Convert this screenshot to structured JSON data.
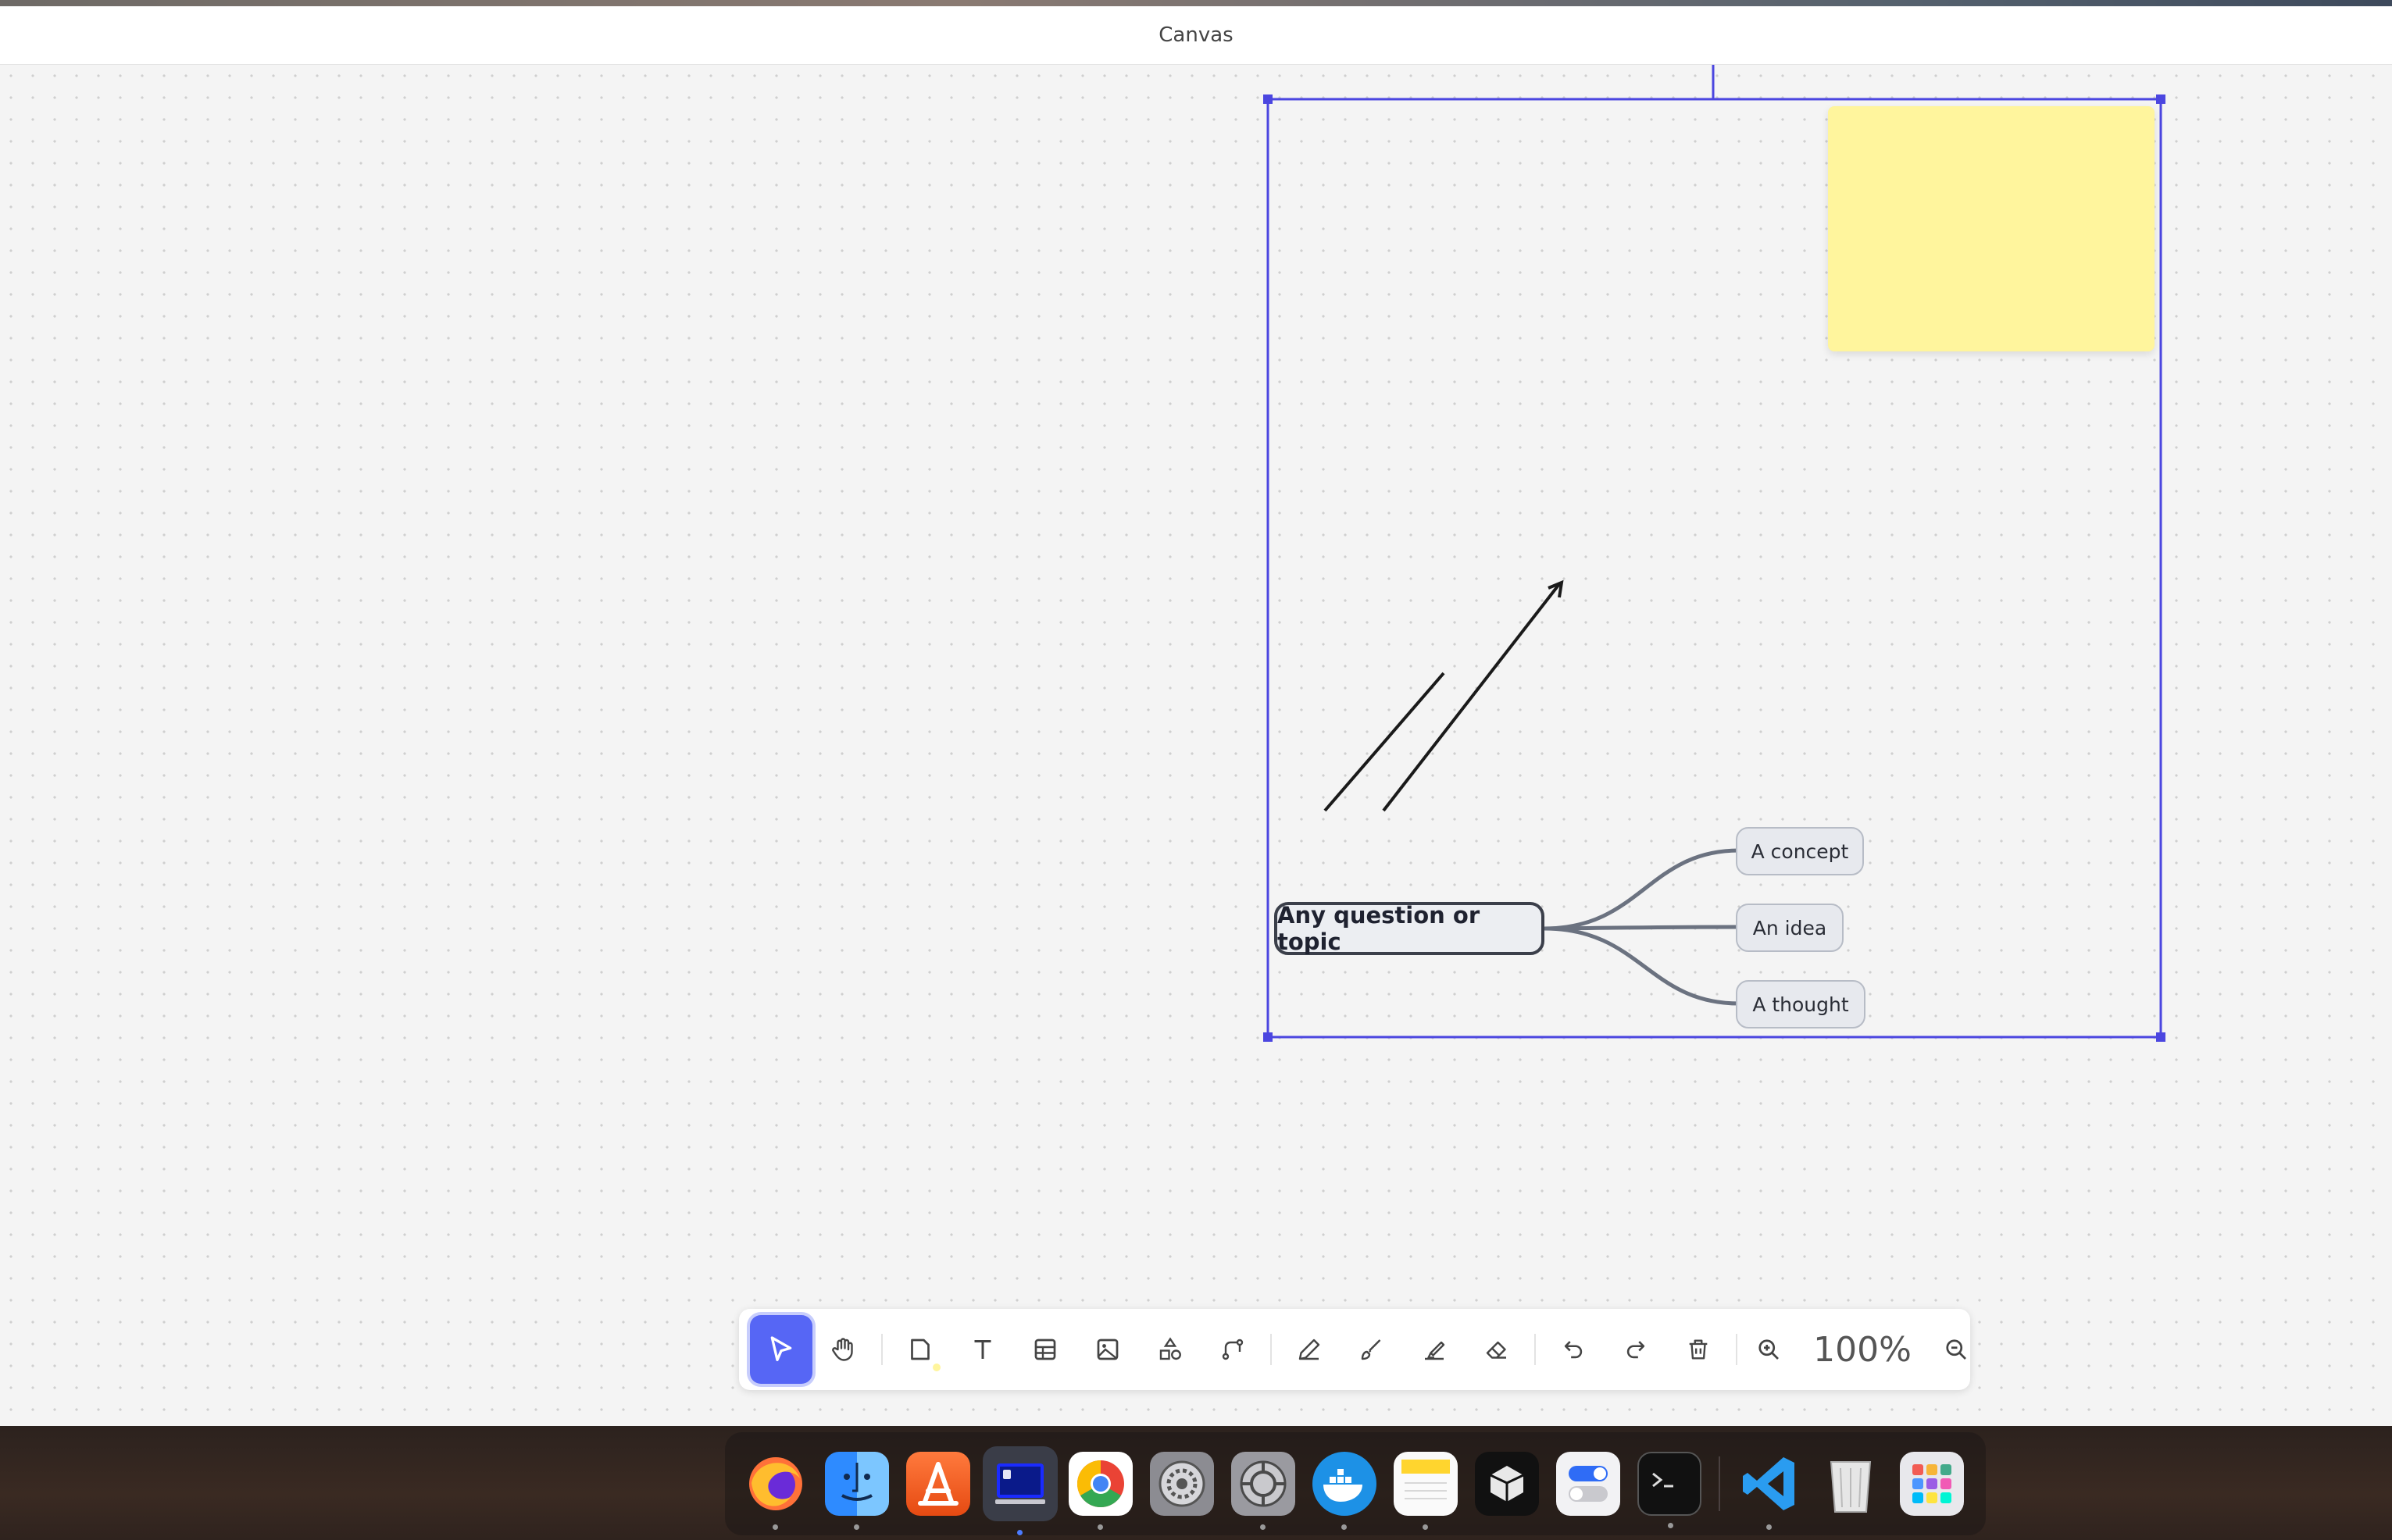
{
  "window": {
    "title": "Canvas"
  },
  "canvas": {
    "sticky_note": {
      "color": "#fff59d",
      "text": ""
    },
    "mindmap": {
      "root": "Any question or topic",
      "children": [
        "A concept",
        "An idea",
        "A thought"
      ]
    },
    "selection_color": "#4b46e0"
  },
  "toolbar": {
    "tools": [
      {
        "name": "select",
        "icon": "pointer-icon",
        "active": true
      },
      {
        "name": "hand",
        "icon": "hand-icon"
      },
      {
        "name": "note",
        "icon": "note-icon"
      },
      {
        "name": "text",
        "icon": "text-icon"
      },
      {
        "name": "table",
        "icon": "table-icon"
      },
      {
        "name": "image",
        "icon": "image-icon"
      },
      {
        "name": "shapes",
        "icon": "shapes-icon"
      },
      {
        "name": "connector",
        "icon": "connector-icon"
      },
      {
        "name": "pen",
        "icon": "pen-icon"
      },
      {
        "name": "brush",
        "icon": "brush-icon"
      },
      {
        "name": "highlighter",
        "icon": "highlighter-icon"
      },
      {
        "name": "eraser",
        "icon": "eraser-icon"
      },
      {
        "name": "undo",
        "icon": "undo-icon"
      },
      {
        "name": "redo",
        "icon": "redo-icon"
      },
      {
        "name": "delete",
        "icon": "trash-icon"
      },
      {
        "name": "zoom-in",
        "icon": "zoom-in-icon"
      },
      {
        "name": "zoom-out",
        "icon": "zoom-out-icon"
      }
    ],
    "zoom": "100%",
    "accent": "#5666f5"
  },
  "dock": {
    "apps": [
      {
        "name": "Firefox",
        "icon": "firefox-icon"
      },
      {
        "name": "Finder",
        "icon": "finder-icon"
      },
      {
        "name": "App Store",
        "icon": "appstore-icon"
      },
      {
        "name": "Canvas",
        "icon": "canvas-app-icon",
        "running": true
      },
      {
        "name": "Chrome",
        "icon": "chrome-icon"
      },
      {
        "name": "System Settings",
        "icon": "settings-icon"
      },
      {
        "name": "System Preferences",
        "icon": "preferences-icon"
      },
      {
        "name": "Docker",
        "icon": "docker-icon"
      },
      {
        "name": "Notes",
        "icon": "notes-icon"
      },
      {
        "name": "Cube",
        "icon": "cube-icon"
      },
      {
        "name": "Toggles",
        "icon": "toggles-icon"
      },
      {
        "name": "Terminal",
        "icon": "terminal-icon"
      },
      {
        "name": "VS Code",
        "icon": "vscode-icon"
      },
      {
        "name": "Trash",
        "icon": "trash-can-icon"
      },
      {
        "name": "Launchpad",
        "icon": "launchpad-icon"
      }
    ]
  }
}
